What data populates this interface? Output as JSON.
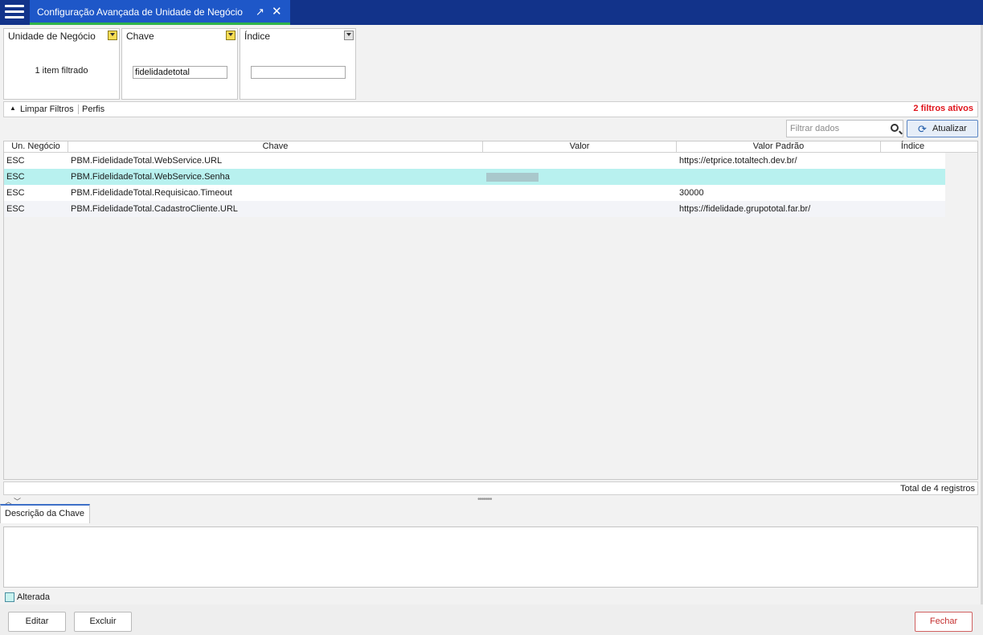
{
  "window": {
    "tab_title": "Configuração Avançada de Unidade de Negócio",
    "pin_glyph": "↗",
    "close_glyph": "✕"
  },
  "filters": {
    "cards": [
      {
        "title": "Unidade de Negócio",
        "info": "1 item filtrado",
        "active": true
      },
      {
        "title": "Chave",
        "value": "fidelidadetotal",
        "active": true
      },
      {
        "title": "Índice",
        "value": "",
        "active": false
      }
    ],
    "clear_label": "Limpar Filtros",
    "profiles_label": "Perfis",
    "active_count_label": "2 filtros ativos"
  },
  "search": {
    "placeholder": "Filtrar dados"
  },
  "refresh_label": "Atualizar",
  "table": {
    "columns": [
      "Un. Negócio",
      "Chave",
      "Valor",
      "Valor Padrão",
      "Índice"
    ],
    "rows": [
      {
        "un": "ESC",
        "chave": "PBM.FidelidadeTotal.WebService.URL",
        "valor": "",
        "padrao": "https://etprice.totaltech.dev.br/",
        "indice": ""
      },
      {
        "un": "ESC",
        "chave": "PBM.FidelidadeTotal.WebService.Senha",
        "valor": "",
        "padrao": "",
        "indice": ""
      },
      {
        "un": "ESC",
        "chave": "PBM.FidelidadeTotal.Requisicao.Timeout",
        "valor": "",
        "padrao": "30000",
        "indice": ""
      },
      {
        "un": "ESC",
        "chave": "PBM.FidelidadeTotal.CadastroCliente.URL",
        "valor": "",
        "padrao": "https://fidelidade.grupototal.far.br/",
        "indice": ""
      }
    ],
    "selected_row": 1,
    "total_label": "Total de 4 registros"
  },
  "description": {
    "tab_label": "Descrição da Chave",
    "text": ""
  },
  "checkbox": {
    "label": "Alterada",
    "checked": false
  },
  "buttons": {
    "edit": "Editar",
    "delete": "Excluir",
    "close": "Fechar"
  },
  "colors": {
    "topbar": "#12338a",
    "active_tab": "#1e57c8",
    "tab_underline": "#2fb34a",
    "selected_row": "#b8f1ef",
    "active_filters": "#e0141b"
  }
}
